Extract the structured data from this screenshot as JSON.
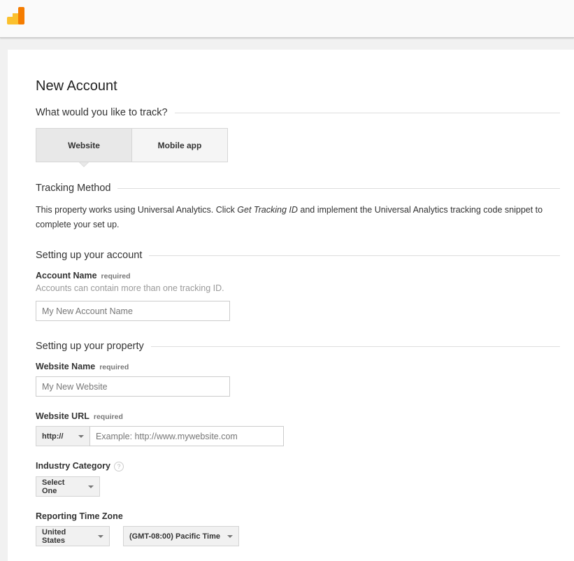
{
  "header": {
    "logo": "analytics-logo"
  },
  "page": {
    "title": "New Account"
  },
  "track": {
    "heading": "What would you like to track?",
    "options": [
      {
        "label": "Website",
        "selected": true
      },
      {
        "label": "Mobile app",
        "selected": false
      }
    ]
  },
  "tracking_method": {
    "heading": "Tracking Method",
    "text_before": "This property works using Universal Analytics. Click ",
    "text_em": "Get Tracking ID",
    "text_after": " and implement the Universal Analytics tracking code snippet to complete your set up."
  },
  "account": {
    "heading": "Setting up your account",
    "name_label": "Account Name",
    "required": "required",
    "hint": "Accounts can contain more than one tracking ID.",
    "name_placeholder": "My New Account Name",
    "name_value": ""
  },
  "property": {
    "heading": "Setting up your property",
    "website_name_label": "Website Name",
    "website_name_placeholder": "My New Website",
    "website_name_value": "",
    "website_url_label": "Website URL",
    "protocol": "http://",
    "url_placeholder": "Example: http://www.mywebsite.com",
    "url_value": "",
    "industry_label": "Industry Category",
    "help_glyph": "?",
    "industry_selected": "Select One",
    "timezone_label": "Reporting Time Zone",
    "country_selected": "United States",
    "timezone_selected": "(GMT-08:00) Pacific Time"
  },
  "colors": {
    "logo_yellow": "#FBC02D",
    "logo_orange": "#F57C00"
  }
}
